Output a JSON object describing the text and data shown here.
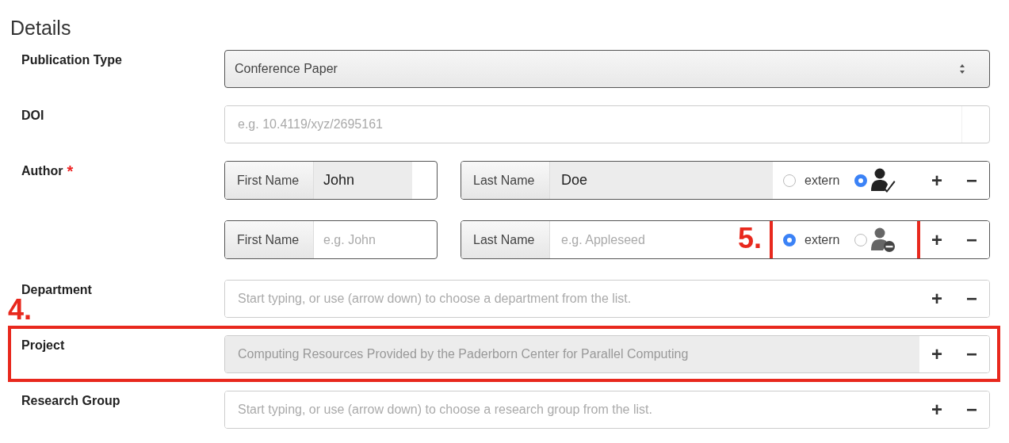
{
  "heading": "Details",
  "fields": [
    {
      "kind": "select",
      "label": "Publication Type",
      "value": "Conference Paper"
    },
    {
      "kind": "text",
      "label": "DOI",
      "placeholder": "e.g. 10.4119/xyz/2695161"
    },
    {
      "kind": "authors",
      "label": "Author",
      "required_mark": "*",
      "authors": [
        {
          "first_name": {
            "label": "First Name",
            "value": "John"
          },
          "last_name": {
            "label": "Last Name",
            "value": "Doe"
          },
          "extern": {
            "label": "extern",
            "selected": false
          },
          "intern": {
            "selected": true
          },
          "buttons": [
            "+",
            "−"
          ]
        },
        {
          "first_name": {
            "label": "First Name",
            "placeholder": "e.g. John"
          },
          "last_name": {
            "label": "Last Name",
            "placeholder": "e.g. Appleseed"
          },
          "extern": {
            "label": "extern",
            "selected": true
          },
          "intern": {
            "selected": false
          },
          "buttons": [
            "+",
            "−"
          ],
          "annotation": "5."
        }
      ]
    },
    {
      "kind": "lookup",
      "label": "Department",
      "placeholder": "Start typing, or use (arrow down) to choose a department from the list.",
      "disabled": false,
      "buttons": [
        "+",
        "−"
      ]
    },
    {
      "kind": "lookup",
      "label": "Project",
      "value": "Computing Resources Provided by the Paderborn Center for Parallel Computing",
      "disabled": true,
      "buttons": [
        "+",
        "−"
      ],
      "annotation": "4."
    },
    {
      "kind": "lookup",
      "label": "Research Group",
      "placeholder": "Start typing, or use (arrow down) to choose a research group from the list.",
      "disabled": false,
      "buttons": [
        "+",
        "−"
      ]
    }
  ]
}
